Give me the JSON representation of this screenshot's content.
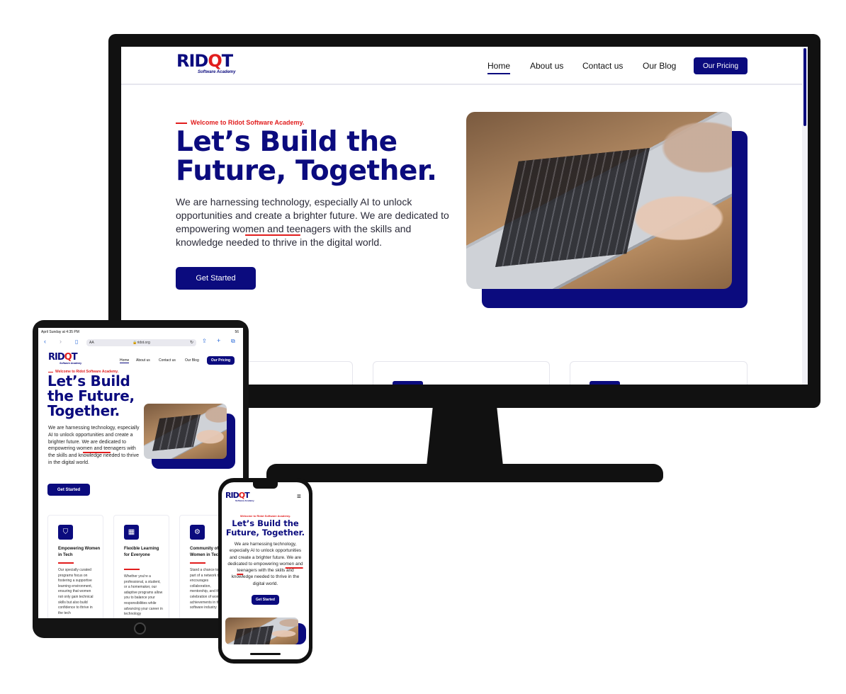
{
  "brand": {
    "logo_text_left": "RID",
    "logo_text_q": "Q",
    "logo_text_right": "T",
    "logo_subtitle": "Software Academy",
    "primary_color": "#0b0b7e",
    "accent_color": "#e11d1d"
  },
  "nav": {
    "home": "Home",
    "about": "About us",
    "contact": "Contact us",
    "blog": "Our Blog",
    "pricing": "Our Pricing"
  },
  "hero": {
    "tagline": "Welcome to Ridot Software Academy.",
    "headline_line1": "Let’s Build the",
    "headline_line2": "Future, Together.",
    "body_part1": "We are harnessing technology, especially AI to unlock opportunities and create a brighter future. We are dedicated to empowering wo",
    "body_underlined": "men and tee",
    "body_part2": "nagers with the skills and knowledge needed to thrive in the digital world.",
    "cta": "Get Started"
  },
  "tablet": {
    "status_left": "April Sunday at 4:35 PM",
    "status_right": "56",
    "url_prefix": "AA",
    "url": "ridot.org",
    "headline_line1": "Let’s Build",
    "headline_line2": "the Future,",
    "headline_line3": "Together.",
    "cards": [
      {
        "icon": "certificate-icon",
        "title": "Empowering Women in Tech",
        "text": "Our specially curated programs focus on fostering a supportive learning environment, ensuring that women not only gain technical skills but also build confidence to thrive in the tech"
      },
      {
        "icon": "calendar-icon",
        "title": "Flexible Learning for Everyone",
        "text": "Whether you're a professional, a student, or a homemaker, our adaptive programs allow you to balance your responsibilities while advancing your career in technology"
      },
      {
        "icon": "community-icon",
        "title": "Community of Women in Tech",
        "text": "Stand a chance to be part of a network that encourages collaboration, mentorship, and the celebration of women's achievements in the software industry"
      }
    ]
  },
  "phone": {
    "headline_line1": "Let’s Build the",
    "headline_line2": "Future, Together."
  }
}
